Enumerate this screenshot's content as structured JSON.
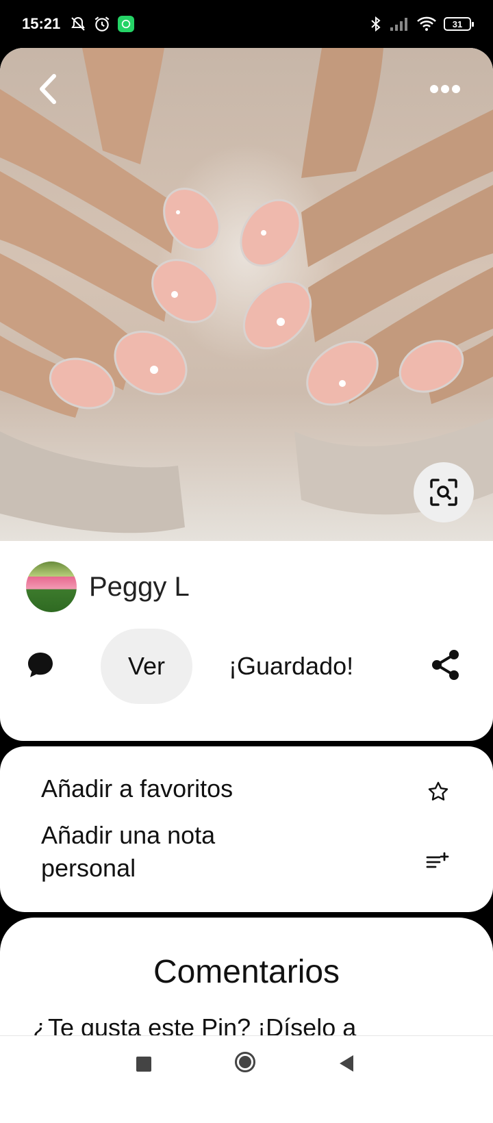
{
  "status_bar": {
    "time": "15:21",
    "battery": "31",
    "icons": [
      "notifications-off-icon",
      "alarm-icon",
      "whatsapp-icon",
      "bluetooth-icon",
      "signal-icon",
      "wifi-icon",
      "battery-icon"
    ]
  },
  "pin": {
    "author": "Peggy L",
    "actions": {
      "view_label": "Ver",
      "saved_label": "¡Guardado!"
    }
  },
  "options": {
    "favorite_label": "Añadir a favoritos",
    "note_label": "Añadir una nota personal"
  },
  "comments": {
    "title": "Comentarios",
    "prompt": "¿Te gusta este Pin? ¡Díselo a"
  },
  "colors": {
    "card": "#ffffff",
    "pill": "#efefef",
    "whatsapp": "#25d366"
  }
}
